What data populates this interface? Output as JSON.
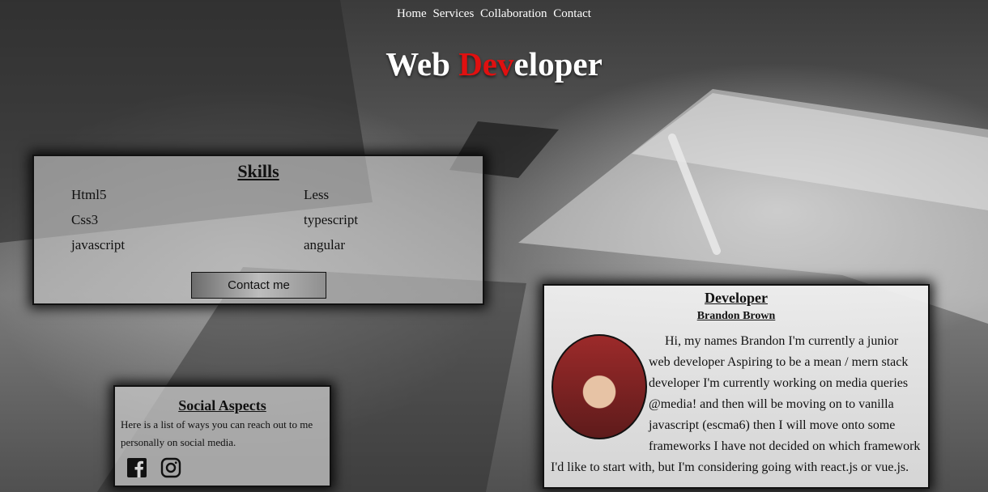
{
  "nav": {
    "items": [
      "Home",
      "Services",
      "Collaboration",
      "Contact"
    ]
  },
  "hero": {
    "part1": "Web ",
    "part2": "Dev",
    "part3": "eloper"
  },
  "skills": {
    "title": "Skills",
    "items": [
      "Html5",
      "Less",
      "Css3",
      "typescript",
      "javascript",
      "angular"
    ],
    "button_label": "Contact me"
  },
  "developer": {
    "title": "Developer",
    "name": "Brandon Brown",
    "bio": "Hi, my names Brandon I'm currently a junior web developer Aspiring to be a mean / mern stack developer I'm currently working on media queries @media! and then will be moving on to vanilla javascript (escma6) then I will move onto some frameworks I have not decided on which framework I'd like to start with, but I'm considering going with react.js or vue.js."
  },
  "social": {
    "title": "Social Aspects",
    "text": "Here is a list of ways you can reach out to me personally on social media.",
    "icons": [
      "facebook-icon",
      "instagram-icon"
    ]
  },
  "colors": {
    "accent": "#e01010"
  }
}
